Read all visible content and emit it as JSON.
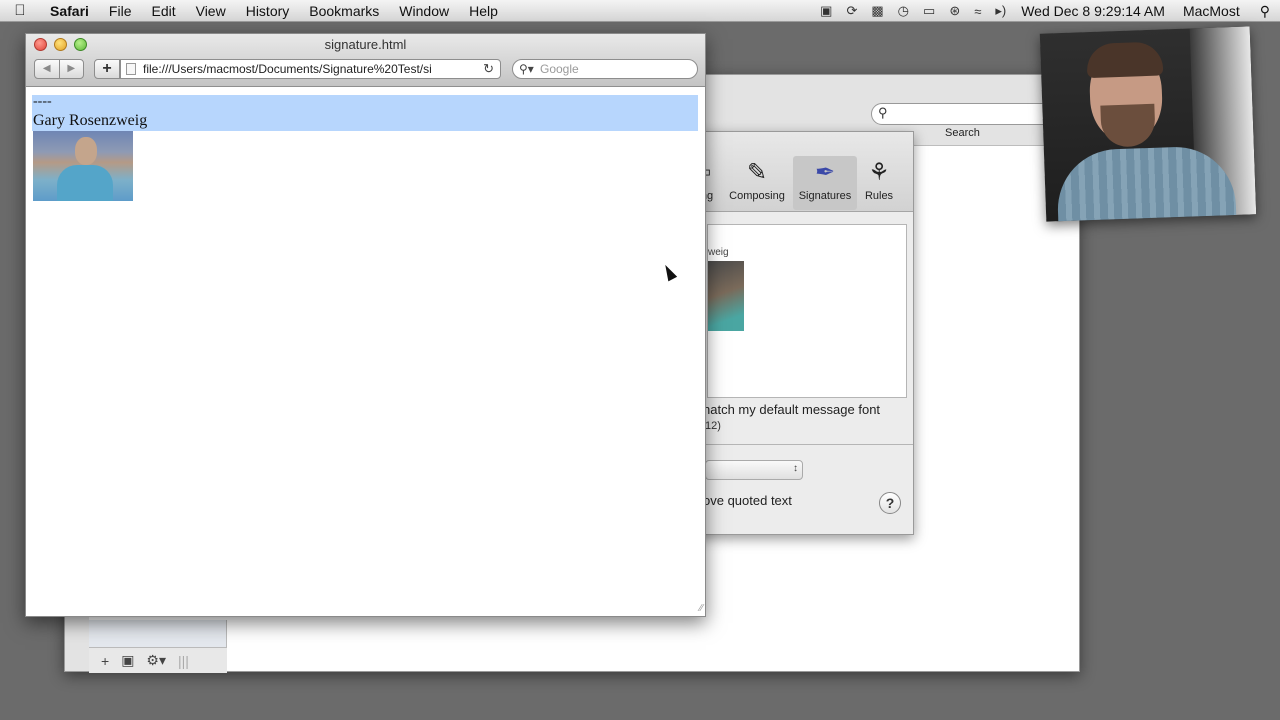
{
  "menubar": {
    "apple_label": "",
    "app_name": "Safari",
    "menus": [
      "File",
      "Edit",
      "View",
      "History",
      "Bookmarks",
      "Window",
      "Help"
    ],
    "clock": "Wed Dec 8  9:29:14 AM",
    "user": "MacMost"
  },
  "safari": {
    "title": "signature.html",
    "url": "file:///Users/macmost/Documents/Signature%20Test/si",
    "search_placeholder": "Google",
    "content": {
      "dash": "----",
      "name": "Gary Rosenzweig"
    }
  },
  "mail": {
    "search_label": "Search"
  },
  "preferences": {
    "toolbar": [
      {
        "label": "ng",
        "icon": "general-icon"
      },
      {
        "label": "Composing",
        "icon": "composing-icon"
      },
      {
        "label": "Signatures",
        "icon": "signatures-icon",
        "selected": true
      },
      {
        "label": "Rules",
        "icon": "rules-icon"
      }
    ],
    "sig_preview_name": "weig",
    "font_option": "natch my default message font",
    "font_size": "12)",
    "quoted_option": "ove quoted text",
    "help_label": "?"
  },
  "icons": {
    "apple": "apple-icon",
    "spotlight": "search-icon",
    "wifi": "wifi-icon",
    "volume": "volume-icon"
  }
}
